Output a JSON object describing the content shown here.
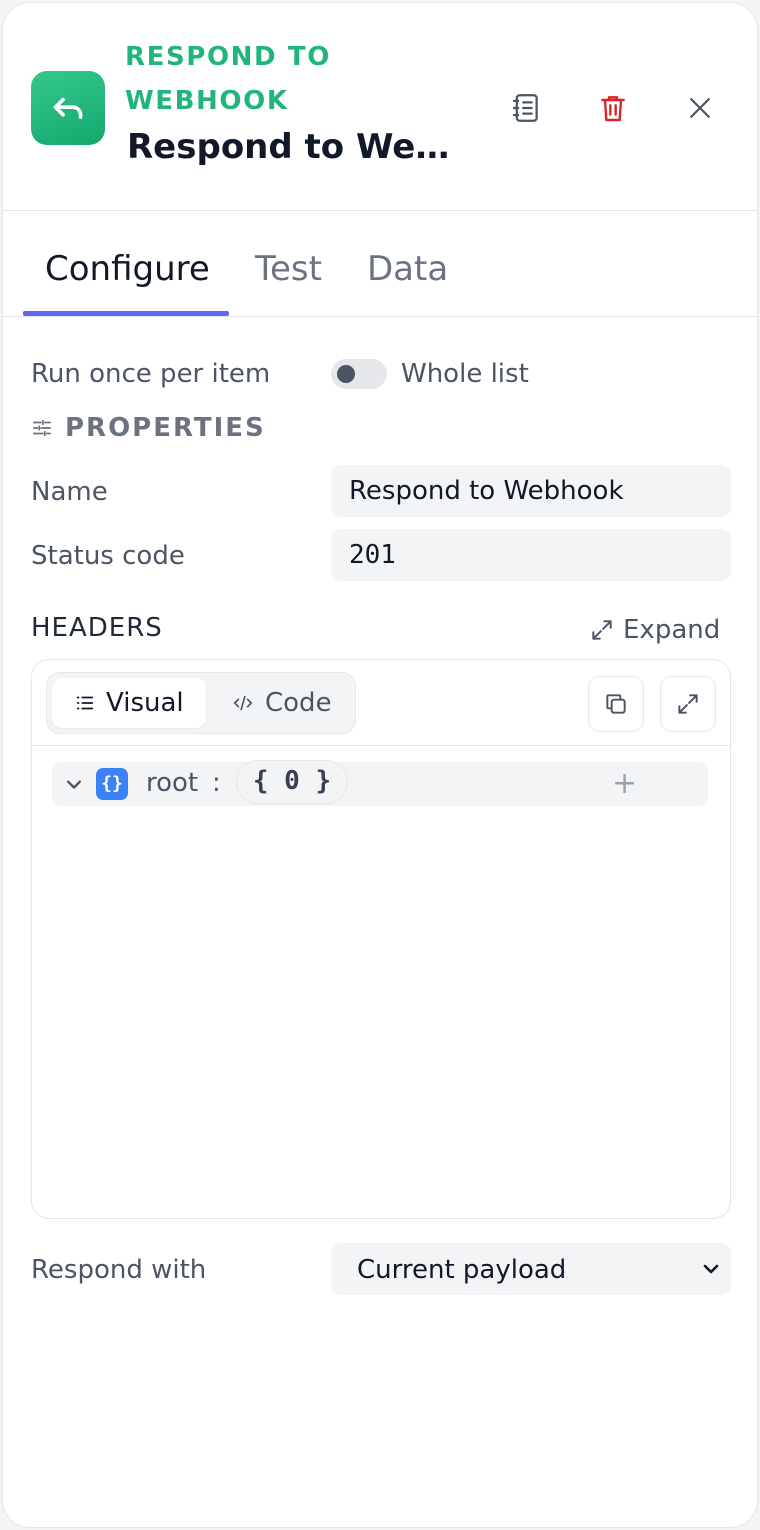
{
  "header": {
    "node_kind": "RESPOND TO WEBHOOK",
    "node_title": "Respond to Web...",
    "accent": "#1fb57b",
    "icons": {
      "app": "reply-arrow-icon",
      "notes": "notebook-icon",
      "delete": "trash-icon",
      "close": "close-icon"
    }
  },
  "tabs": [
    {
      "label": "Configure",
      "active": true
    },
    {
      "label": "Test",
      "active": false
    },
    {
      "label": "Data",
      "active": false
    }
  ],
  "mode": {
    "label": "Run once per item",
    "toggle_label": "Whole list",
    "toggle_on": false
  },
  "properties": {
    "section_title": "PROPERTIES",
    "name_label": "Name",
    "name_value": "Respond to Webhook",
    "status_label": "Status code",
    "status_value": "201"
  },
  "headers": {
    "label": "HEADERS",
    "expand_label": "Expand",
    "segments": [
      {
        "label": "Visual",
        "active": true
      },
      {
        "label": "Code",
        "active": false
      }
    ],
    "tree": {
      "badge": "{}",
      "key": "root",
      "separator": ":",
      "summary": "{ 0 }",
      "add": "+"
    }
  },
  "respond": {
    "label": "Respond with",
    "selected": "Current payload"
  },
  "colors": {
    "tab_indicator": "#6366f1",
    "object_badge": "#3b82f6",
    "danger": "#dc2626"
  }
}
